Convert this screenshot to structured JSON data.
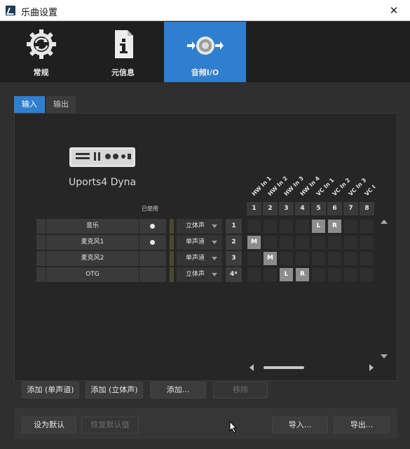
{
  "window": {
    "title": "乐曲设置",
    "close_glyph": "✕"
  },
  "nav": [
    {
      "label": "常规",
      "icon": "gear-icon"
    },
    {
      "label": "元信息",
      "icon": "document-info-icon"
    },
    {
      "label": "音频I/O",
      "icon": "audio-io-icon"
    }
  ],
  "tabs": {
    "input": "输入",
    "output": "输出"
  },
  "device": {
    "name": "Uports4 Dyna",
    "icon": "audio-interface-icon"
  },
  "table": {
    "used_header": "已使用",
    "rows": [
      {
        "name": "音乐",
        "used": true,
        "mode": "立体声",
        "number": "1"
      },
      {
        "name": "麦克风1",
        "used": true,
        "mode": "单声道",
        "number": "2"
      },
      {
        "name": "麦克风2",
        "used": false,
        "mode": "单声道",
        "number": "3"
      },
      {
        "name": "OTG",
        "used": false,
        "mode": "立体声",
        "number": "4*"
      }
    ]
  },
  "channels": {
    "headers": [
      "HW In 1",
      "HW In 2",
      "HW In 3",
      "HW In 4",
      "VC In 1",
      "VC In 2",
      "VC In 3",
      "VC I"
    ],
    "numbers": [
      "1",
      "2",
      "3",
      "4",
      "5",
      "6",
      "7",
      "8"
    ],
    "assignments": [
      {
        "row": 0,
        "col": 4,
        "label": "L"
      },
      {
        "row": 0,
        "col": 5,
        "label": "R"
      },
      {
        "row": 1,
        "col": 0,
        "label": "M"
      },
      {
        "row": 2,
        "col": 1,
        "label": "M"
      },
      {
        "row": 3,
        "col": 2,
        "label": "L"
      },
      {
        "row": 3,
        "col": 3,
        "label": "R"
      }
    ]
  },
  "buttons": {
    "add_mono": "添加 (单声道)",
    "add_stereo": "添加 (立体声)",
    "add": "添加...",
    "remove": "移除"
  },
  "footer": {
    "set_default": "设为默认",
    "restore_default": "恢复默认值",
    "import": "导入...",
    "export": "导出..."
  },
  "colors": {
    "accent": "#2f7fd0",
    "background": "#2b2b2b",
    "panel": "#262626"
  }
}
